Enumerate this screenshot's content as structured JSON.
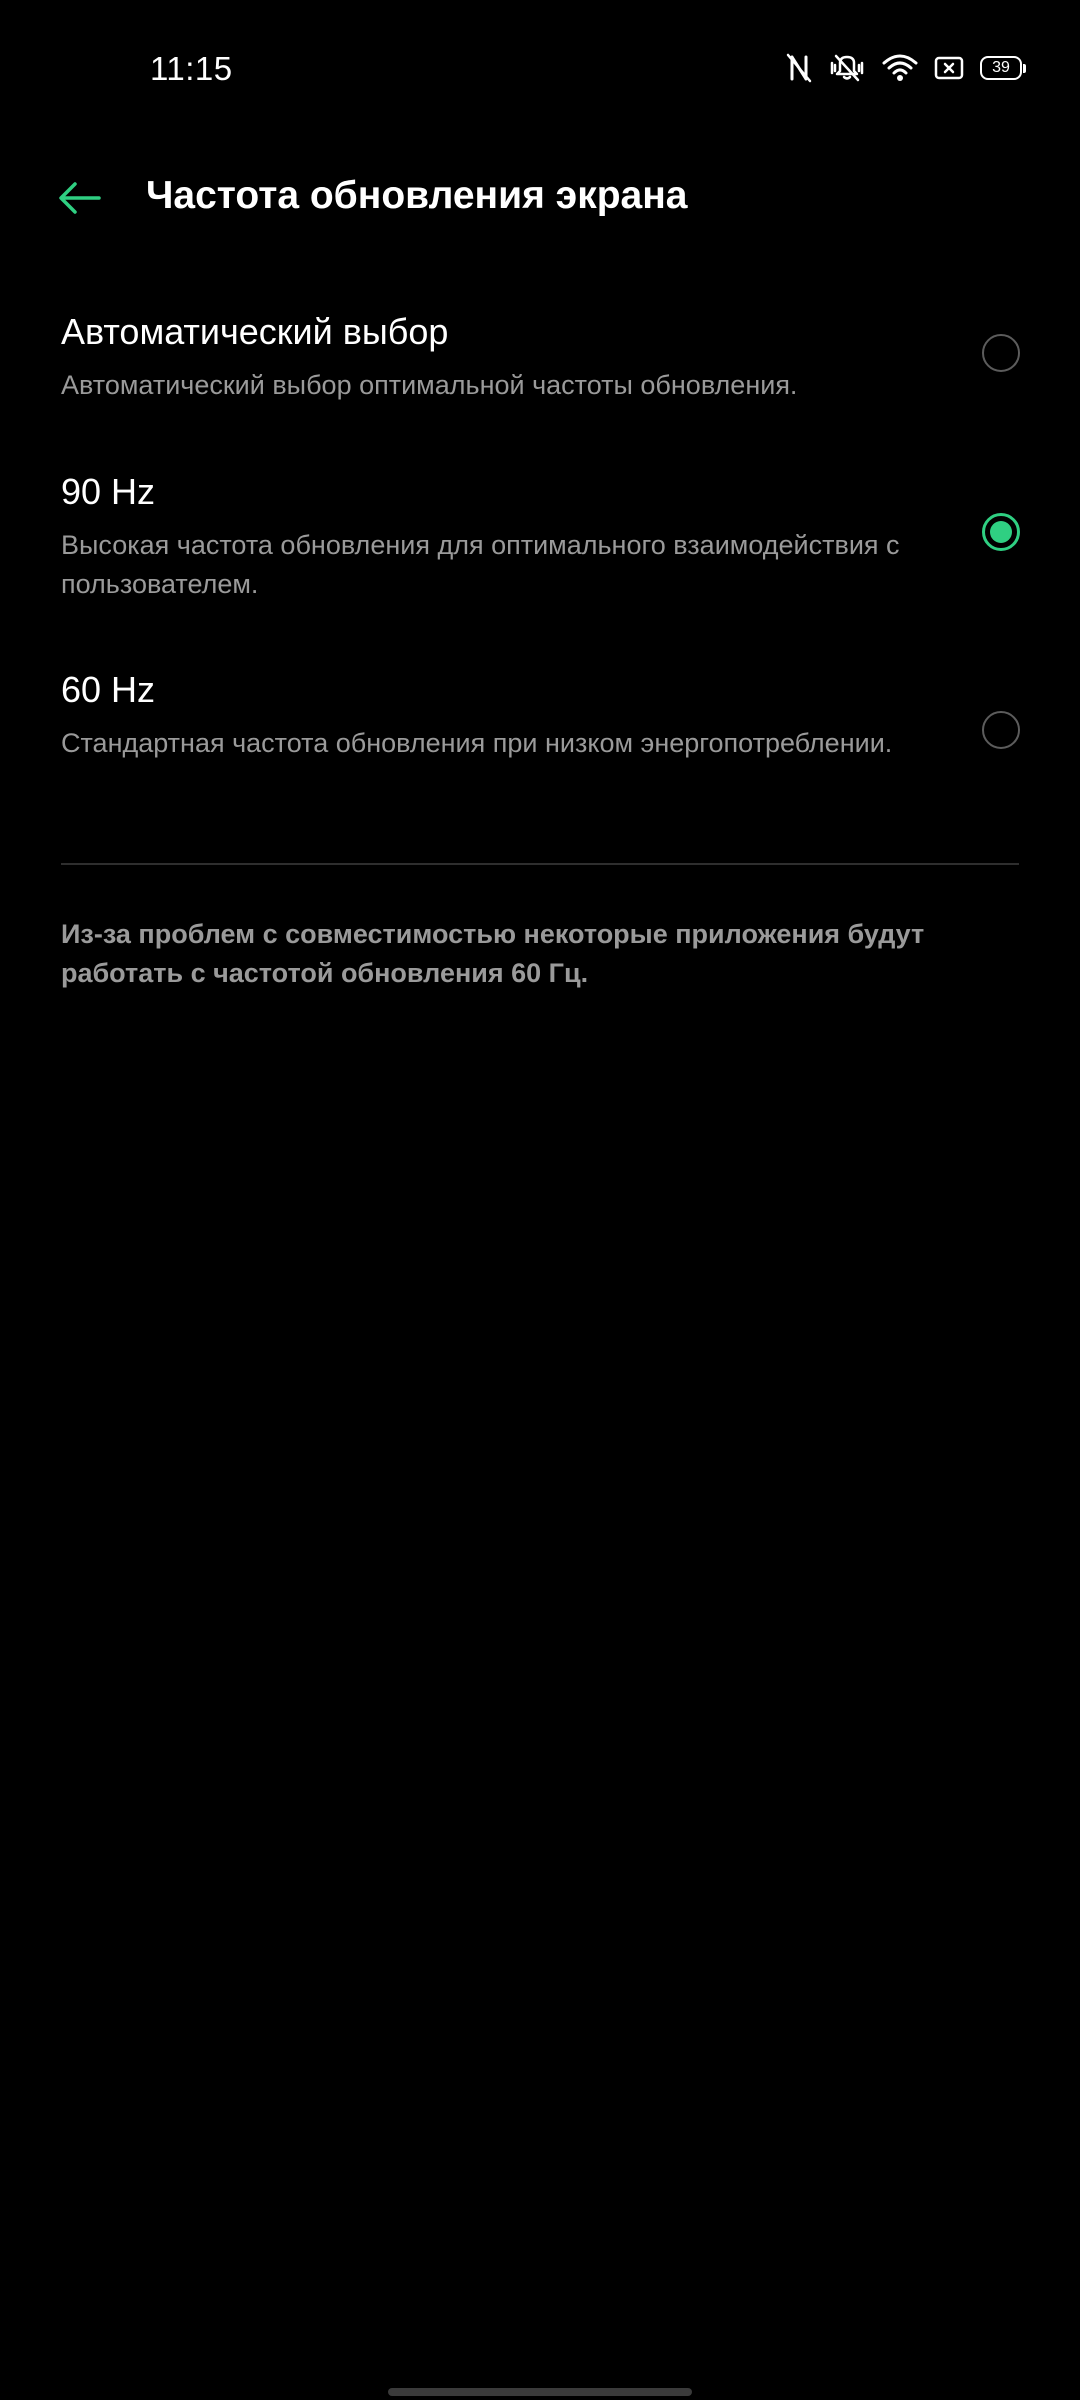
{
  "status_bar": {
    "time": "11:15",
    "battery_level": "39",
    "icons": [
      "nfc-icon",
      "vibrate-icon",
      "wifi-icon",
      "sim-icon",
      "battery-icon"
    ]
  },
  "header": {
    "title": "Частота обновления экрана",
    "back_icon": "arrow-left-icon"
  },
  "options": [
    {
      "title": "Автоматический выбор",
      "description": "Автоматический выбор оптимальной частоты обновления.",
      "selected": false
    },
    {
      "title": "90 Hz",
      "description": "Высокая частота обновления для оптимального взаимодействия с пользователем.",
      "selected": true
    },
    {
      "title": "60 Hz",
      "description": "Стандартная частота обновления при низком энергопотреблении.",
      "selected": false
    }
  ],
  "footer_note": "Из-за проблем с совместимостью некоторые приложения будут работать с частотой обновления 60 Гц.",
  "colors": {
    "accent": "#2fcf82",
    "background": "#000000",
    "secondary_text": "#9a9a9a"
  }
}
